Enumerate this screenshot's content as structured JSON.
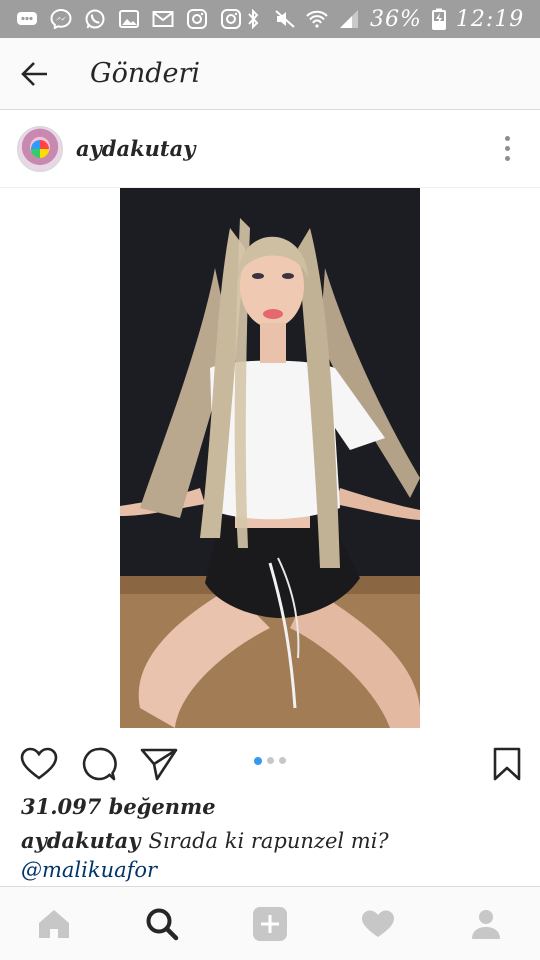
{
  "status_bar": {
    "battery": "36%",
    "time": "12:19",
    "icons": [
      "chat-notification-icon",
      "messenger-icon",
      "whatsapp-icon",
      "gallery-icon",
      "email-icon",
      "instagram-icon",
      "instagram-icon",
      "bluetooth-icon",
      "mute-icon",
      "wifi-icon",
      "signal-icon",
      "battery-charging-icon"
    ]
  },
  "header": {
    "title": "Gönderi",
    "back_icon": "arrow-left-icon"
  },
  "post": {
    "username": "aydakutay",
    "more_icon": "more-vertical-icon",
    "carousel": {
      "current": 1,
      "total": 3
    },
    "likes": "31.097 beğenme",
    "caption_user": "aydakutay",
    "caption_text": "Sırada ki rapunzel mi?",
    "mention": "@malikuafor"
  },
  "bottom_nav": {
    "items": [
      "home-icon",
      "search-icon",
      "add-post-icon",
      "activity-heart-icon",
      "profile-icon"
    ],
    "active": "search-icon"
  },
  "colors": {
    "accent": "#3897f0",
    "mention": "#003569",
    "status_bar": "#9e9e9e",
    "inactive_icon": "#c7c7c7"
  }
}
